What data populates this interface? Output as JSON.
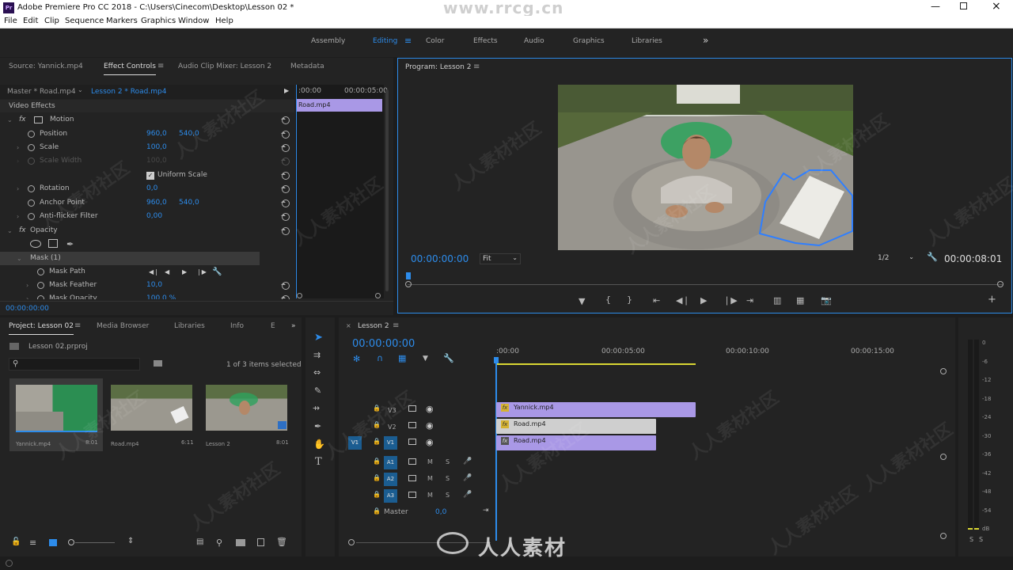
{
  "window": {
    "title": "Adobe Premiere Pro CC 2018 - C:\\Users\\Cinecom\\Desktop\\Lesson 02 *",
    "logo": "Pr",
    "watermark_url": "www.rrcg.cn"
  },
  "menu": [
    "File",
    "Edit",
    "Clip",
    "Sequence",
    "Markers",
    "Graphics",
    "Window",
    "Help"
  ],
  "workspaces": {
    "items": [
      "Assembly",
      "Editing",
      "Color",
      "Effects",
      "Audio",
      "Graphics",
      "Libraries"
    ],
    "active": "Editing",
    "more": "»"
  },
  "source_panel": {
    "tabs": [
      "Source: Yannick.mp4",
      "Effect Controls",
      "Audio Clip Mixer: Lesson 2",
      "Metadata"
    ],
    "active_tab": "Effect Controls",
    "master_label": "Master * Road.mp4",
    "sequence_clip": "Lesson 2 * Road.mp4",
    "mini_timecode_start": ":00:00",
    "mini_timecode_end": "00:00:05:00",
    "mini_clip": "Road.mp4",
    "section_title": "Video Effects",
    "motion": "Motion",
    "props": [
      {
        "name": "Position",
        "v1": "960,0",
        "v2": "540,0"
      },
      {
        "name": "Scale",
        "v1": "100,0",
        "v2": ""
      },
      {
        "name": "Scale Width",
        "v1": "100,0",
        "v2": ""
      },
      {
        "name": "Uniform Scale",
        "v1": "",
        "v2": ""
      },
      {
        "name": "Rotation",
        "v1": "0,0",
        "v2": ""
      },
      {
        "name": "Anchor Point",
        "v1": "960,0",
        "v2": "540,0"
      },
      {
        "name": "Anti-flicker Filter",
        "v1": "0,00",
        "v2": ""
      }
    ],
    "opacity": "Opacity",
    "mask_name": "Mask (1)",
    "mask_props": [
      {
        "name": "Mask Path",
        "v1": ""
      },
      {
        "name": "Mask Feather",
        "v1": "10,0"
      },
      {
        "name": "Mask Opacity",
        "v1": "100,0 %"
      }
    ],
    "timecode": "00:00:00:00"
  },
  "program_panel": {
    "title": "Program: Lesson 2",
    "timecode_current": "00:00:00:00",
    "zoom": "Fit",
    "resolution": "1/2",
    "timecode_duration": "00:00:08:01"
  },
  "project_panel": {
    "tabs": [
      "Project: Lesson 02",
      "Media Browser",
      "Libraries",
      "Info",
      "E"
    ],
    "active_tab": "Project: Lesson 02",
    "file_name": "Lesson 02.prproj",
    "search_placeholder": "",
    "selection_text": "1 of 3 items selected",
    "items": [
      {
        "name": "Yannick.mp4",
        "duration": "8:01",
        "thumb": "green"
      },
      {
        "name": "Road.mp4",
        "duration": "6:11",
        "thumb": "road"
      },
      {
        "name": "Lesson 2",
        "duration": "8:01",
        "thumb": "man"
      }
    ]
  },
  "timeline": {
    "title": "Lesson 2",
    "timecode": "00:00:00:00",
    "ruler": [
      ":00:00",
      "00:00:05:00",
      "00:00:10:00",
      "00:00:15:00"
    ],
    "video_tracks": [
      {
        "name": "V3",
        "clip": "Yannick.mp4",
        "start_sec": 0,
        "end_sec": 8.01,
        "color": "#a998e6",
        "fx": true
      },
      {
        "name": "V2",
        "clip": "Road.mp4",
        "start_sec": 0,
        "end_sec": 6.11,
        "color": "#cfcfcf",
        "fx": true
      },
      {
        "name": "V1",
        "clip": "Road.mp4",
        "start_sec": 0,
        "end_sec": 6.11,
        "color": "#a998e6",
        "fx": false
      }
    ],
    "source_patch": "V1",
    "audio_tracks": [
      "A1",
      "A2",
      "A3"
    ],
    "master_label": "Master",
    "master_value": "0,0",
    "m_label": "M",
    "s_label": "S"
  },
  "audio_meter": {
    "scale": [
      "0",
      "-6",
      "-12",
      "-18",
      "-24",
      "-30",
      "-36",
      "-42",
      "-48",
      "-54",
      "dB"
    ],
    "solo": [
      "S",
      "S"
    ]
  },
  "bottom_watermark": "人人素材",
  "bg_watermark": "人人素材社区"
}
